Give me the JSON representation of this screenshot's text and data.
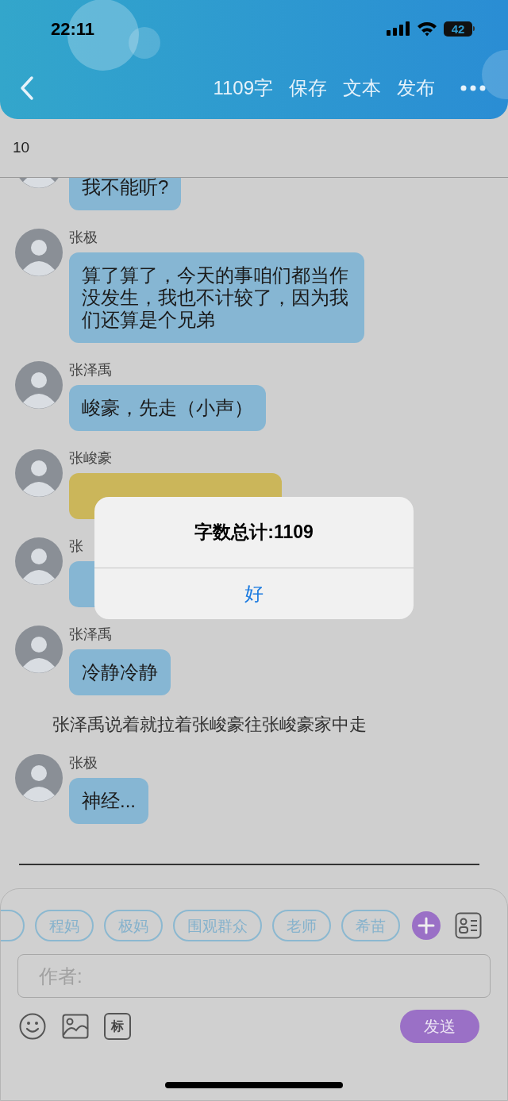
{
  "status_bar": {
    "time": "22:11",
    "battery": "42"
  },
  "header": {
    "actions": [
      {
        "label": "1109字"
      },
      {
        "label": "保存"
      },
      {
        "label": "文本"
      },
      {
        "label": "发布"
      }
    ]
  },
  "subheader": {
    "text": "10"
  },
  "messages": [
    {
      "kind": "message",
      "text": "我不能听?",
      "color": "#86b6d3"
    },
    {
      "kind": "message",
      "name": "张极",
      "text": "算了算了，今天的事咱们都当作没发生，我也不计较了，因为我们还算是个兄弟",
      "color": "#86b6d3"
    },
    {
      "kind": "message",
      "name": "张泽禹",
      "text": "峻豪，先走（小声）",
      "color": "#86b6d3"
    },
    {
      "kind": "message",
      "name": "张峻豪",
      "covered": true,
      "color": "#cbb65a"
    },
    {
      "kind": "message",
      "name": "张",
      "covered": true,
      "color": "#86b6d3"
    },
    {
      "kind": "message",
      "name": "张泽禹",
      "text": "冷静冷静",
      "color": "#86b6d3"
    },
    {
      "kind": "narration",
      "text": "张泽禹说着就拉着张峻豪往张峻豪家中走"
    },
    {
      "kind": "message",
      "name": "张极",
      "text": "神经...",
      "color": "#86b6d3"
    }
  ],
  "dialog": {
    "title": "字数总计:1109",
    "button": "好"
  },
  "composer": {
    "chips": [
      {
        "label": "程妈"
      },
      {
        "label": "极妈"
      },
      {
        "label": "围观群众"
      },
      {
        "label": "老师"
      },
      {
        "label": "希苗"
      }
    ],
    "placeholder": "作者:",
    "tool_label": "标",
    "send": "发送"
  }
}
